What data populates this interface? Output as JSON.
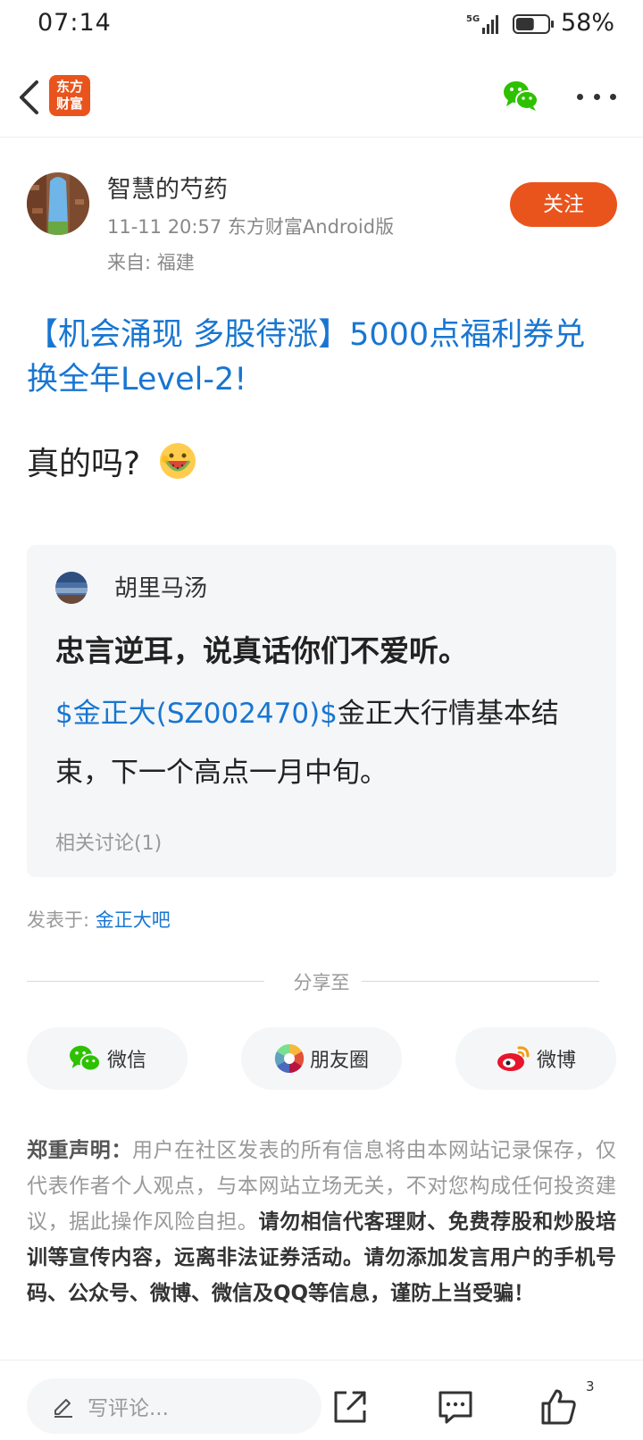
{
  "status_bar": {
    "time": "07:14",
    "network": "5G",
    "battery_percent": "58%",
    "battery_level": 0.58
  },
  "nav": {
    "logo_line1": "东方",
    "logo_line2": "财富",
    "brand_color": "#e9541d"
  },
  "author": {
    "name": "智慧的芍药",
    "meta": "11-11 20:57 东方财富Android版",
    "location": "来自: 福建",
    "follow_label": "关注"
  },
  "post": {
    "title": "【机会涌现 多股待涨】5000点福利券兑换全年Level-2!",
    "body": "真的吗?",
    "body_emoji": "watermelon-face-emoji"
  },
  "quote": {
    "user": "胡里马汤",
    "headline": "忠言逆耳，说真话你们不爱听。",
    "stock_tag": "$金正大(SZ002470)$",
    "text": "金正大行情基本结束，下一个高点一月中旬。",
    "related": "相关讨论(1)"
  },
  "posted_in": {
    "label": "发表于: ",
    "bar_name": "金正大吧"
  },
  "share": {
    "label": "分享至",
    "wechat": "微信",
    "moments": "朋友圈",
    "weibo": "微博"
  },
  "disclaimer": {
    "heading": "郑重声明：",
    "normal": "用户在社区发表的所有信息将由本网站记录保存，仅代表作者个人观点，与本网站立场无关，不对您构成任何投资建议，据此操作风险自担。",
    "strong": "请勿相信代客理财、免费荐股和炒股培训等宣传内容，远离非法证券活动。请勿添加发言用户的手机号码、公众号、微博、微信及QQ等信息，谨防上当受骗！"
  },
  "bottom_bar": {
    "comment_placeholder": "写评论...",
    "like_count": "3"
  },
  "colors": {
    "accent_blue": "#1876d1",
    "accent_orange": "#e9541d",
    "wechat_green": "#2dc100"
  }
}
